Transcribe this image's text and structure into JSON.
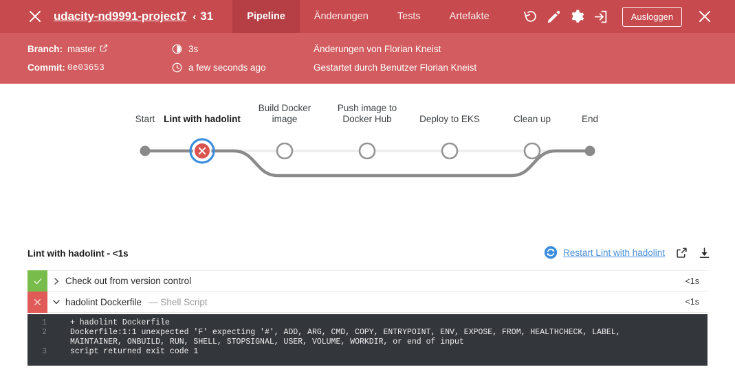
{
  "header": {
    "close_icon": "close-icon",
    "repo_name": "udacity-nd9991-project7",
    "run_separator": "‹",
    "run_number": "31",
    "tabs": [
      {
        "label": "Pipeline",
        "active": true
      },
      {
        "label": "Änderungen",
        "active": false
      },
      {
        "label": "Tests",
        "active": false
      },
      {
        "label": "Artefakte",
        "active": false
      }
    ],
    "icons": [
      {
        "name": "replay-icon"
      },
      {
        "name": "edit-pencil-icon"
      },
      {
        "name": "gear-icon"
      },
      {
        "name": "logout-arrow-icon"
      }
    ],
    "logout_label": "Ausloggen",
    "window_close_icon": "close-icon",
    "bg_color": "#c74a4e",
    "active_tab_color": "#b53f44"
  },
  "meta": {
    "bg_color": "#d25c5f",
    "branch_label": "Branch:",
    "branch_value": "master",
    "branch_external_icon": "external-link-icon",
    "commit_label": "Commit:",
    "commit_value": "0e03653",
    "duration_icon": "duration-pie-icon",
    "duration_value": "3s",
    "time_icon": "clock-icon",
    "time_value": "a few seconds ago",
    "changes_by": "Änderungen von Florian Kneist",
    "started_by": "Gestartet durch Benutzer Florian Kneist"
  },
  "pipeline": {
    "start_label": "Start",
    "end_label": "End",
    "nodes": [
      {
        "label": "Lint with hadolint",
        "status": "failed",
        "selected": true
      },
      {
        "label": "Build Docker\nimage",
        "status": "skipped",
        "selected": false
      },
      {
        "label": "Push image to\nDocker Hub",
        "status": "skipped",
        "selected": false
      },
      {
        "label": "Deploy to EKS",
        "status": "skipped",
        "selected": false
      },
      {
        "label": "Clean up",
        "status": "skipped",
        "selected": false
      }
    ],
    "failed_color": "#d9534f",
    "selection_color": "#3b8ede",
    "line_active_color": "#8a8a8a",
    "line_skipped_color": "#efefef"
  },
  "stage": {
    "title": "Lint with hadolint - <1s",
    "restart_icon": "restart-circle-icon",
    "restart_link": "Restart Lint with hadolint",
    "open_external_icon": "open-external-icon",
    "download_icon": "download-icon",
    "steps": [
      {
        "status": "success",
        "status_icon": "check-icon",
        "chevron": "chevron-right-icon",
        "label": "Check out from version control",
        "sub": "",
        "time": "<1s"
      },
      {
        "status": "failed",
        "status_icon": "x-icon",
        "chevron": "chevron-down-icon",
        "label": "hadolint Dockerfile",
        "sub": "— Shell Script",
        "time": "<1s"
      }
    ]
  },
  "log": {
    "bg_color": "#33363b",
    "lines": [
      {
        "num": "1",
        "text": "+ hadolint Dockerfile"
      },
      {
        "num": "2",
        "text": "Dockerfile:1:1 unexpected 'F' expecting '#', ADD, ARG, CMD, COPY, ENTRYPOINT, ENV, EXPOSE, FROM, HEALTHCHECK, LABEL,"
      },
      {
        "num": "",
        "text": "MAINTAINER, ONBUILD, RUN, SHELL, STOPSIGNAL, USER, VOLUME, WORKDIR, or end of input"
      },
      {
        "num": "3",
        "text": "script returned exit code 1"
      }
    ]
  }
}
